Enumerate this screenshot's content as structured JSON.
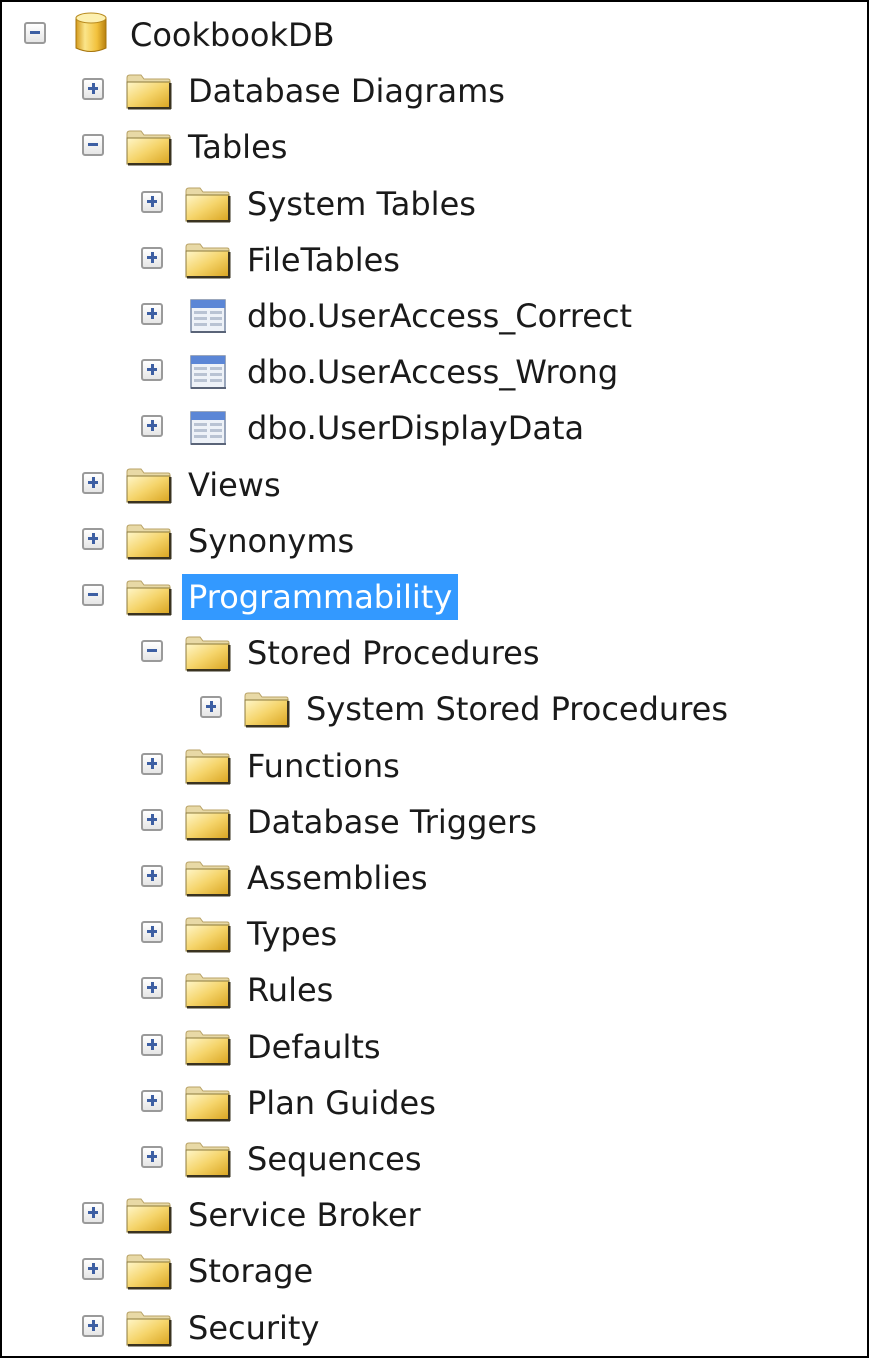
{
  "panel": "Object Explorer",
  "selected_item": "Programmability",
  "colors": {
    "selection_bg": "#3399ff",
    "selection_text": "#ffffff",
    "text": "#1a1a1a",
    "expander_glyph": "#3d5fa3",
    "border": "#000000"
  },
  "tree": [
    {
      "label": "CookbookDB",
      "level": 0,
      "icon": "database-icon",
      "state": "expanded"
    },
    {
      "label": "Database Diagrams",
      "level": 1,
      "icon": "folder-icon",
      "state": "collapsed"
    },
    {
      "label": "Tables",
      "level": 1,
      "icon": "folder-icon",
      "state": "expanded"
    },
    {
      "label": "System Tables",
      "level": 2,
      "icon": "folder-icon",
      "state": "collapsed"
    },
    {
      "label": "FileTables",
      "level": 2,
      "icon": "folder-icon",
      "state": "collapsed"
    },
    {
      "label": "dbo.UserAccess_Correct",
      "level": 2,
      "icon": "table-icon",
      "state": "collapsed"
    },
    {
      "label": "dbo.UserAccess_Wrong",
      "level": 2,
      "icon": "table-icon",
      "state": "collapsed"
    },
    {
      "label": "dbo.UserDisplayData",
      "level": 2,
      "icon": "table-icon",
      "state": "collapsed"
    },
    {
      "label": "Views",
      "level": 1,
      "icon": "folder-icon",
      "state": "collapsed"
    },
    {
      "label": "Synonyms",
      "level": 1,
      "icon": "folder-icon",
      "state": "collapsed"
    },
    {
      "label": "Programmability",
      "level": 1,
      "icon": "folder-icon",
      "state": "expanded",
      "selected": true
    },
    {
      "label": "Stored Procedures",
      "level": 2,
      "icon": "folder-icon",
      "state": "expanded"
    },
    {
      "label": "System Stored Procedures",
      "level": 3,
      "icon": "folder-icon",
      "state": "collapsed"
    },
    {
      "label": "Functions",
      "level": 2,
      "icon": "folder-icon",
      "state": "collapsed"
    },
    {
      "label": "Database Triggers",
      "level": 2,
      "icon": "folder-icon",
      "state": "collapsed"
    },
    {
      "label": "Assemblies",
      "level": 2,
      "icon": "folder-icon",
      "state": "collapsed"
    },
    {
      "label": "Types",
      "level": 2,
      "icon": "folder-icon",
      "state": "collapsed"
    },
    {
      "label": "Rules",
      "level": 2,
      "icon": "folder-icon",
      "state": "collapsed"
    },
    {
      "label": "Defaults",
      "level": 2,
      "icon": "folder-icon",
      "state": "collapsed"
    },
    {
      "label": "Plan Guides",
      "level": 2,
      "icon": "folder-icon",
      "state": "collapsed"
    },
    {
      "label": "Sequences",
      "level": 2,
      "icon": "folder-icon",
      "state": "collapsed"
    },
    {
      "label": "Service Broker",
      "level": 1,
      "icon": "folder-icon",
      "state": "collapsed"
    },
    {
      "label": "Storage",
      "level": 1,
      "icon": "folder-icon",
      "state": "collapsed"
    },
    {
      "label": "Security",
      "level": 1,
      "icon": "folder-icon",
      "state": "collapsed"
    }
  ]
}
